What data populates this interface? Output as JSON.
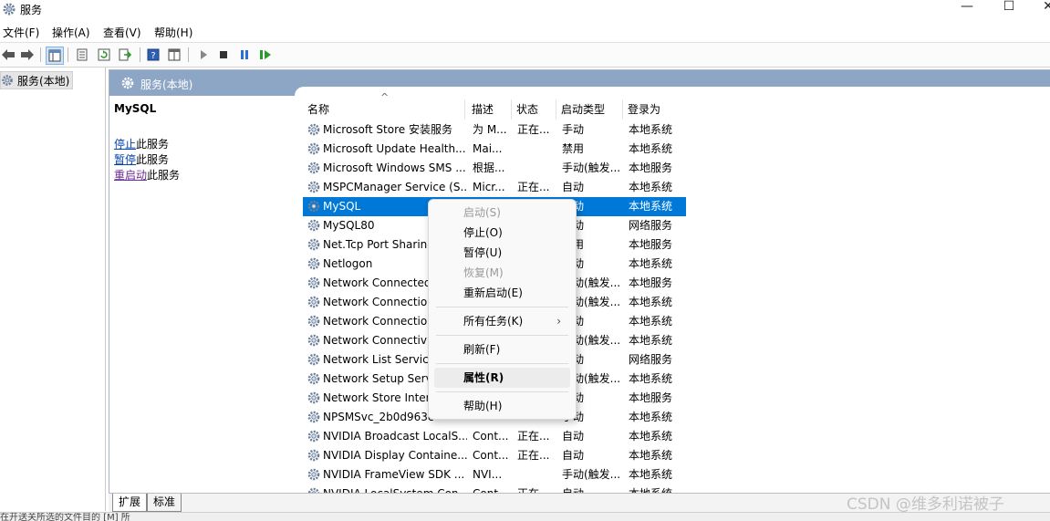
{
  "window": {
    "title": "服务",
    "minimize_glyph": "—",
    "maximize_glyph": "☐",
    "close_glyph": "✕"
  },
  "menubar": [
    {
      "label": "文件(F)"
    },
    {
      "label": "操作(A)"
    },
    {
      "label": "查看(V)"
    },
    {
      "label": "帮助(H)"
    }
  ],
  "toolbar": {
    "icons": [
      "back-icon",
      "forward-icon",
      "show-tree-icon",
      "properties-icon",
      "refresh-icon",
      "export-icon",
      "help-icon",
      "console-icon",
      "play-icon",
      "stop-icon",
      "pause-icon",
      "restart-icon"
    ]
  },
  "tree": {
    "item": "服务(本地)"
  },
  "pane": {
    "header": "服务(本地)",
    "selected_name": "MySQL",
    "actions": [
      {
        "link": "停止",
        "text": "此服务"
      },
      {
        "link": "暂停",
        "text": "此服务"
      },
      {
        "link": "重启动",
        "text": "此服务"
      }
    ]
  },
  "columns": {
    "name": "名称",
    "desc": "描述",
    "status": "状态",
    "startup": "启动类型",
    "logon": "登录为"
  },
  "rows": [
    {
      "name": "Microsoft Store 安装服务",
      "desc": "为 M...",
      "status": "正在...",
      "startup": "手动",
      "logon": "本地系统"
    },
    {
      "name": "Microsoft Update Health...",
      "desc": "Mai...",
      "status": "",
      "startup": "禁用",
      "logon": "本地系统"
    },
    {
      "name": "Microsoft Windows SMS ...",
      "desc": "根据...",
      "status": "",
      "startup": "手动(触发...",
      "logon": "本地服务"
    },
    {
      "name": "MSPCManager Service (S...",
      "desc": "Micr...",
      "status": "正在...",
      "startup": "自动",
      "logon": "本地系统"
    },
    {
      "name": "MySQL",
      "desc": "",
      "status": "正在...",
      "startup": "自动",
      "logon": "本地系统"
    },
    {
      "name": "MySQL80",
      "desc": "",
      "status": "",
      "startup": "自动",
      "logon": "网络服务"
    },
    {
      "name": "Net.Tcp Port Sharing Se...",
      "desc": "",
      "status": "",
      "startup": "禁用",
      "logon": "本地服务"
    },
    {
      "name": "Netlogon",
      "desc": "",
      "status": "",
      "startup": "手动",
      "logon": "本地系统"
    },
    {
      "name": "Network Connected Dev...",
      "desc": "",
      "status": "",
      "startup": "手动(触发...",
      "logon": "本地服务"
    },
    {
      "name": "Network Connection Bro...",
      "desc": "",
      "status": "",
      "startup": "手动(触发...",
      "logon": "本地系统"
    },
    {
      "name": "Network Connections",
      "desc": "",
      "status": "",
      "startup": "手动",
      "logon": "本地系统"
    },
    {
      "name": "Network Connectivity As...",
      "desc": "",
      "status": "",
      "startup": "手动(触发...",
      "logon": "本地系统"
    },
    {
      "name": "Network List Service",
      "desc": "",
      "status": "",
      "startup": "手动",
      "logon": "网络服务"
    },
    {
      "name": "Network Setup Service",
      "desc": "",
      "status": "",
      "startup": "手动(触发...",
      "logon": "本地系统"
    },
    {
      "name": "Network Store Interface...",
      "desc": "",
      "status": "",
      "startup": "自动",
      "logon": "本地服务"
    },
    {
      "name": "NPSMSvc_2b0d963c",
      "desc": "",
      "status": "",
      "startup": "手动",
      "logon": "本地系统"
    },
    {
      "name": "NVIDIA Broadcast LocalS...",
      "desc": "Cont...",
      "status": "正在...",
      "startup": "自动",
      "logon": "本地系统"
    },
    {
      "name": "NVIDIA Display Containe...",
      "desc": "Cont...",
      "status": "正在...",
      "startup": "自动",
      "logon": "本地系统"
    },
    {
      "name": "NVIDIA FrameView SDK ...",
      "desc": "NVI...",
      "status": "",
      "startup": "手动(触发...",
      "logon": "本地系统"
    },
    {
      "name": "NVIDIA LocalSystem Con...",
      "desc": "Cont...",
      "status": "正在...",
      "startup": "自动",
      "logon": "本地系统"
    }
  ],
  "context_menu": {
    "start": "启动(S)",
    "stop": "停止(O)",
    "pause": "暂停(U)",
    "resume": "恢复(M)",
    "restart": "重新启动(E)",
    "all_tasks": "所有任务(K)",
    "all_tasks_arrow": "›",
    "refresh": "刷新(F)",
    "properties": "属性(R)",
    "help": "帮助(H)"
  },
  "bottom_tabs": [
    "扩展",
    "标准"
  ],
  "statusbar": {
    "text": "在开送关所选的文件目的 [M] 所"
  },
  "watermark": "CSDN @维多利诺被子",
  "colors": {
    "selection": "#0078d7",
    "pane_header": "#8ea6c6",
    "link": "#0645ad"
  }
}
